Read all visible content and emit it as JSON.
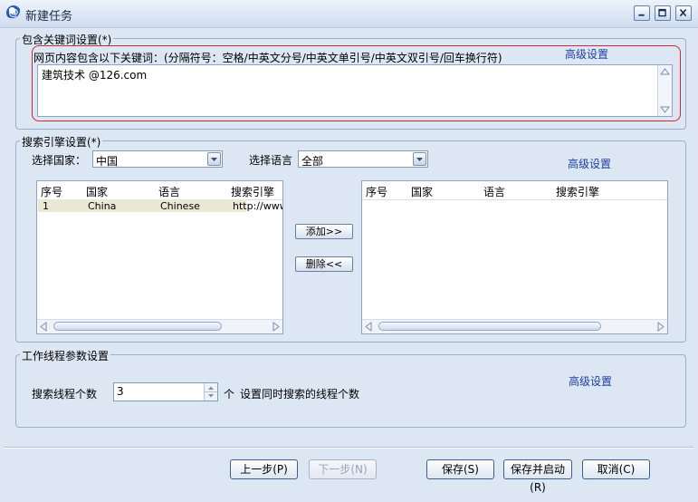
{
  "window": {
    "title": "新建任务",
    "app_icon_glyph": "@"
  },
  "keywords_group": {
    "legend": "包含关键词设置(*)",
    "instruction": "网页内容包含以下关键词：(分隔符号：空格/中英文分号/中英文单引号/中英文双引号/回车换行符)",
    "advanced_link": "高级设置",
    "value": "建筑技术 @126.com"
  },
  "engine_group": {
    "legend": "搜索引擎设置(*)",
    "country_label": "选择国家：",
    "country_value": "中国",
    "language_label": "选择语言",
    "language_value": "全部",
    "advanced_link": "高级设置",
    "columns": [
      "序号",
      "国家",
      "语言",
      "搜索引擎"
    ],
    "available_rows": [
      {
        "index": "1",
        "country": "China",
        "language": "Chinese",
        "engine": "http://www"
      }
    ],
    "selected_columns": [
      "序号",
      "国家",
      "语言",
      "搜索引擎"
    ],
    "add_button": "添加>>",
    "remove_button": "删除<<"
  },
  "thread_group": {
    "legend": "工作线程参数设置",
    "threads_label": "搜索线程个数",
    "threads_value": "3",
    "unit_label": "个",
    "hint": "设置同时搜索的线程个数",
    "advanced_link": "高级设置"
  },
  "footer": {
    "prev_button": "上一步(P)",
    "next_button": "下一步(N)",
    "save_button": "保存(S)",
    "save_start_button": "保存并启动(R)",
    "cancel_button": "取消(C)"
  },
  "colors": {
    "highlight_outline": "#d0283a",
    "link": "#1c3ea8",
    "background": "#dde6f3"
  }
}
